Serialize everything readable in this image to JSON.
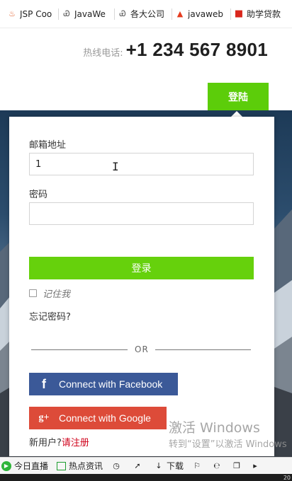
{
  "bookmarks": [
    {
      "label": "JSP Coo",
      "icon": "jsp-icon",
      "icon_char": "♨"
    },
    {
      "label": "JavaWe",
      "icon": "link-icon",
      "icon_char": "Ꮿ"
    },
    {
      "label": "各大公司",
      "icon": "link-icon",
      "icon_char": "Ꮿ"
    },
    {
      "label": "javaweb",
      "icon": "flame-icon",
      "icon_char": "🔥"
    },
    {
      "label": "助学贷款",
      "icon": "square-red-icon",
      "icon_char": "■"
    }
  ],
  "header": {
    "hotline_label": "热线电话:",
    "hotline_number": "+1 234 567 8901",
    "nav_login": "登陆"
  },
  "form": {
    "email_label": "邮箱地址",
    "email_value": "1",
    "password_label": "密码",
    "password_value": "",
    "submit_label": "登录",
    "remember_label": "记住我",
    "forgot_label": "忘记密码?",
    "or_text": "OR",
    "facebook_label": "Connect with Facebook",
    "google_label": "Connect with Google",
    "facebook_icon": "f",
    "google_icon": "g+",
    "newuser_text": "新用户?",
    "register_link": "请注册"
  },
  "watermark": {
    "title": "激活 Windows",
    "subtitle": "转到“设置”以激活 Windows"
  },
  "statusbar": {
    "live": "今日直播",
    "news": "热点资讯",
    "download": "下载",
    "clock": "20"
  },
  "colors": {
    "accent_green": "#5ccd0a",
    "facebook": "#3b5998",
    "google": "#dd4b39",
    "link_red": "#d0021b"
  }
}
